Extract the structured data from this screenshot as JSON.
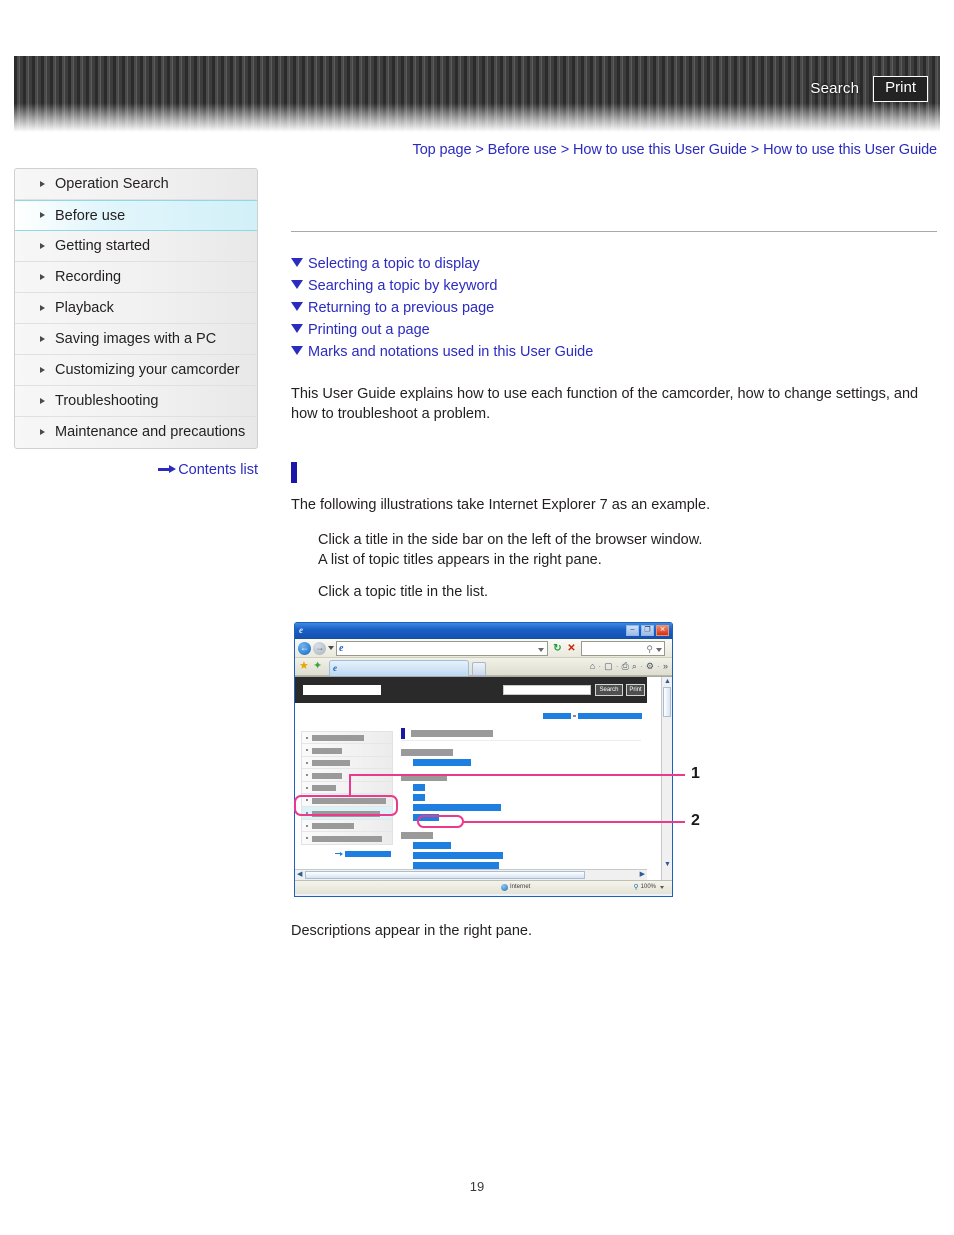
{
  "header": {
    "search_label": "Search",
    "print_label": "Print"
  },
  "breadcrumb": {
    "text": "Top page > Before use > How to use this User Guide > How to use this User Guide"
  },
  "sidebar": {
    "items": [
      {
        "label": "Operation Search",
        "active": false
      },
      {
        "label": "Before use",
        "active": true
      },
      {
        "label": "Getting started",
        "active": false
      },
      {
        "label": "Recording",
        "active": false
      },
      {
        "label": "Playback",
        "active": false
      },
      {
        "label": "Saving images with a PC",
        "active": false
      },
      {
        "label": "Customizing your camcorder",
        "active": false
      },
      {
        "label": "Troubleshooting",
        "active": false
      },
      {
        "label": "Maintenance and precautions",
        "active": false
      }
    ],
    "contents_list_label": "Contents list"
  },
  "main": {
    "topics": [
      {
        "label": "Selecting a topic to display"
      },
      {
        "label": "Searching a topic by keyword"
      },
      {
        "label": "Returning to a previous page"
      },
      {
        "label": "Printing out a page"
      },
      {
        "label": "Marks and notations used in this User Guide"
      }
    ],
    "intro": "This User Guide explains how to use each function of the camcorder, how to change settings, and how to troubleshoot a problem.",
    "section_title": "",
    "step_lead": "The following illustrations take Internet Explorer 7 as an example.",
    "steps": [
      "Click a title in the side bar on the left of the browser window.",
      "A list of topic titles appears in the right pane.",
      "Click a topic title in the list."
    ],
    "closing": "Descriptions appear in the right pane."
  },
  "figure": {
    "callouts": [
      {
        "number": "1"
      },
      {
        "number": "2"
      }
    ],
    "mock_browser": {
      "window_controls": {
        "minimize": "–",
        "maximize": "❐",
        "close": "✕"
      },
      "nav_back": "←",
      "nav_forward": "→",
      "refresh": "↻",
      "stop": "✕",
      "search_magnifier": "⚲",
      "favorites_star": "★",
      "add_favorites": "✦",
      "toolbar_icons": [
        "⌂",
        "▢",
        "⎙",
        "⌕",
        "⚙",
        "»"
      ],
      "mock_page": {
        "search_button": "Search",
        "print_button": "Print"
      },
      "status": {
        "zone": "Internet",
        "zoom": "100%"
      },
      "scroll_arrows": {
        "left": "◀",
        "right": "▶",
        "up": "▲",
        "down": "▼"
      }
    }
  },
  "footer": {
    "page_number": "19"
  },
  "colors": {
    "link_blue": "#2b2bc0",
    "accent_blue": "#1c17a8",
    "callout_pink": "#ea3a8e",
    "active_cyan": "#d2f0f8",
    "mock_link_blue": "#1f7fe0"
  }
}
